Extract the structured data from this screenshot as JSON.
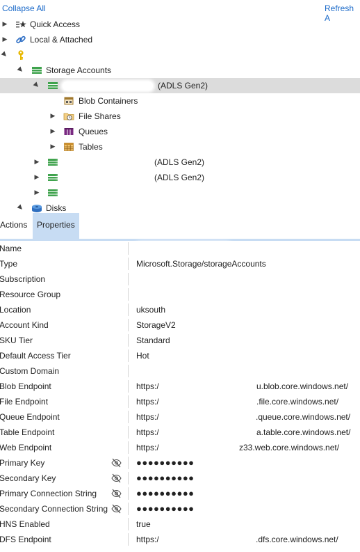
{
  "toolbar": {
    "collapse_all": "Collapse All",
    "refresh_all": "Refresh A"
  },
  "tree": {
    "quick_access": "Quick Access",
    "local_attached": "Local & Attached",
    "storage_accounts": "Storage Accounts",
    "selected_account_suffix": "(ADLS Gen2)",
    "blob_containers": "Blob Containers",
    "file_shares": "File Shares",
    "queues": "Queues",
    "tables": "Tables",
    "account2_suffix": "(ADLS Gen2)",
    "account3_suffix": "(ADLS Gen2)",
    "disks": "Disks"
  },
  "tabs": {
    "actions": "Actions",
    "properties": "Properties"
  },
  "properties": [
    {
      "name": "Name",
      "value": ""
    },
    {
      "name": "Type",
      "value": "Microsoft.Storage/storageAccounts"
    },
    {
      "name": "Subscription",
      "value": ""
    },
    {
      "name": "Resource Group",
      "value": ""
    },
    {
      "name": "Location",
      "value": "uksouth"
    },
    {
      "name": "Account Kind",
      "value": "StorageV2"
    },
    {
      "name": "SKU Tier",
      "value": "Standard"
    },
    {
      "name": "Default Access Tier",
      "value": "Hot"
    },
    {
      "name": "Custom Domain",
      "value": ""
    },
    {
      "name": "Blob Endpoint",
      "value": "https:/",
      "value_tail": "u.blob.core.windows.net/"
    },
    {
      "name": "File Endpoint",
      "value": "https:/",
      "value_tail": ".file.core.windows.net/"
    },
    {
      "name": "Queue Endpoint",
      "value": "https:/",
      "value_tail": ".queue.core.windows.net/"
    },
    {
      "name": "Table Endpoint",
      "value": "https:/",
      "value_tail": "a.table.core.windows.net/"
    },
    {
      "name": "Web Endpoint",
      "value": "https:/",
      "value_tail": "z33.web.core.windows.net/"
    },
    {
      "name": "Primary Key",
      "value": "●●●●●●●●●●"
    },
    {
      "name": "Secondary Key",
      "value": "●●●●●●●●●●"
    },
    {
      "name": "Primary Connection String",
      "value": "●●●●●●●●●●"
    },
    {
      "name": "Secondary Connection String",
      "value": "●●●●●●●●●●"
    },
    {
      "name": "HNS Enabled",
      "value": "true"
    },
    {
      "name": "DFS Endpoint",
      "value": "https:/",
      "value_tail": ".dfs.core.windows.net/"
    }
  ],
  "colors": {
    "link": "#1b6ac9",
    "tab_active": "#c7dcf3",
    "selected_row": "#dcdcdc"
  },
  "icons": [
    "quick-access-icon",
    "link-icon",
    "key-icon",
    "storage-account-icon",
    "blob-container-icon",
    "file-share-icon",
    "queue-icon",
    "table-icon",
    "disk-icon",
    "eye-hidden-icon"
  ]
}
